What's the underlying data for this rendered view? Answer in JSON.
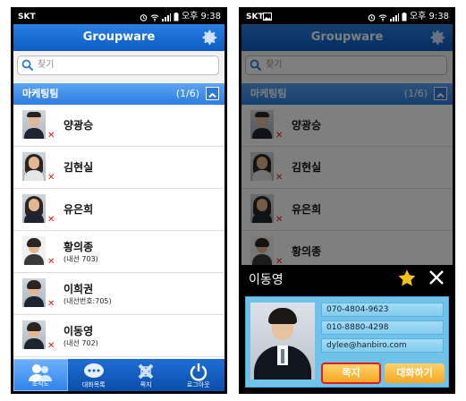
{
  "status": {
    "carrier": "SKT",
    "time": "오후 9:38"
  },
  "app": {
    "title": "Groupware"
  },
  "search": {
    "placeholder": "찾기"
  },
  "group": {
    "name": "마케팅팀",
    "count": "(1/6)"
  },
  "contacts": [
    {
      "name": "양광승",
      "ext": ""
    },
    {
      "name": "김현실",
      "ext": ""
    },
    {
      "name": "유은희",
      "ext": ""
    },
    {
      "name": "황의종",
      "ext": "(내선 703)"
    },
    {
      "name": "이희권",
      "ext": "(내선번호:705)"
    },
    {
      "name": "이동영",
      "ext": "(내선 702)"
    }
  ],
  "tabs": [
    {
      "label": "조직도",
      "icon": "people-icon",
      "active": true
    },
    {
      "label": "대화목록",
      "icon": "chat-bubble-icon",
      "active": false
    },
    {
      "label": "쪽지",
      "icon": "note-icon",
      "active": false
    },
    {
      "label": "로그아웃",
      "icon": "power-icon",
      "active": false
    }
  ],
  "detail": {
    "name": "이동영",
    "phone": "070-4804-9623",
    "mobile": "010-8880-4298",
    "email": "dylee@hanbiro.com",
    "memo_button": "쪽지",
    "chat_button": "대화하기"
  },
  "colors": {
    "header_blue": "#0d5cc3",
    "group_blue": "#2c7ddf",
    "offline_x": "#d4201b",
    "card_blue": "#6fc3ea",
    "button_orange": "#f5a623",
    "highlight_red": "#e01c1c",
    "favorite_star": "#f7c21a"
  }
}
